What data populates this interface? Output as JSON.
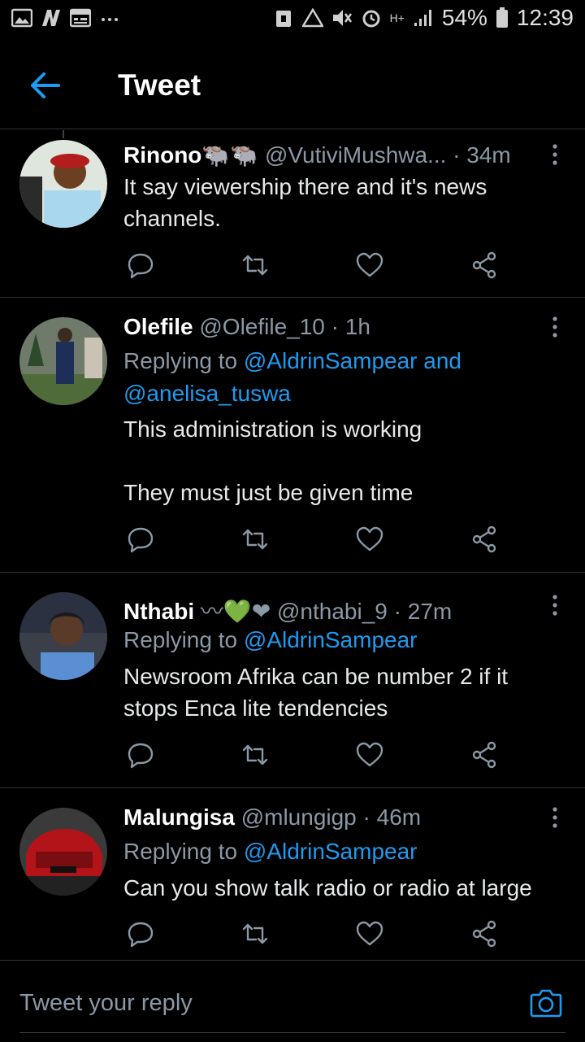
{
  "status_bar": {
    "battery": "54%",
    "time": "12:39",
    "network": "H+"
  },
  "header": {
    "title": "Tweet"
  },
  "tweets": [
    {
      "name": "Rinono",
      "emoji": "🐃🐃",
      "handle": "@VutiviMushwa...",
      "time": "· 34m",
      "replying_prefix": "",
      "mentions": "",
      "body": "It say viewership there and it's news channels."
    },
    {
      "name": "Olefile",
      "emoji": "",
      "handle": "@Olefile_10",
      "time": "· 1h",
      "replying_prefix": "Replying to ",
      "mentions": "@AldrinSampear and @anelisa_tuswa",
      "body": "This administration is working\n\nThey must just be given time"
    },
    {
      "name": "Nthabi",
      "emoji": "〰💚❤",
      "handle": "@nthabi_9",
      "time": "· 27m",
      "replying_prefix": "Replying to ",
      "mentions": "@AldrinSampear",
      "body": "Newsroom Afrika can be number 2 if it stops Enca lite tendencies"
    },
    {
      "name": "Malungisa",
      "emoji": "",
      "handle": "@mlungigp",
      "time": "· 46m",
      "replying_prefix": "Replying to ",
      "mentions": "@AldrinSampear",
      "body": "Can you show talk radio or radio at large"
    }
  ],
  "composer": {
    "placeholder": "Tweet your reply"
  },
  "colors": {
    "accent": "#1d9bf0",
    "muted": "#8b98a5",
    "divider": "#2f3336",
    "background": "#000000"
  }
}
